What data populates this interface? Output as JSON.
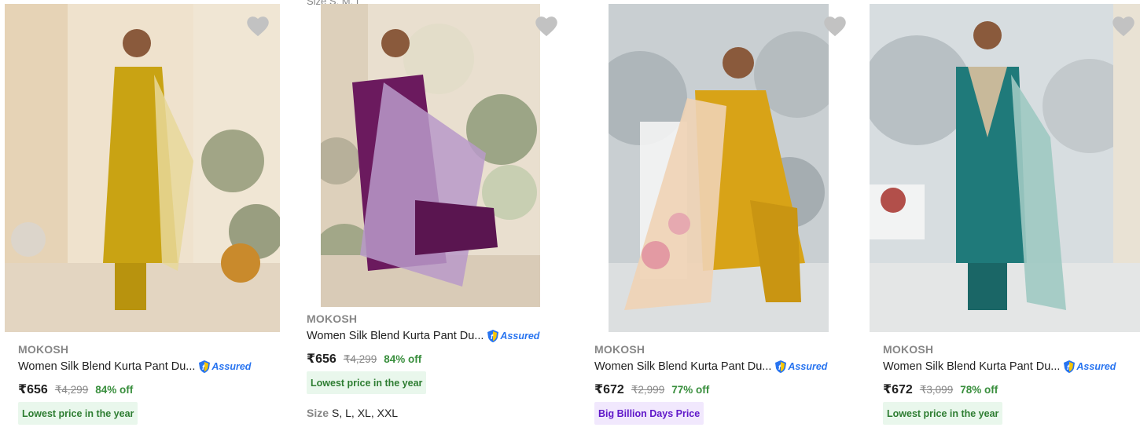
{
  "products": [
    {
      "brand": "MOKOSH",
      "title": "Women Silk Blend Kurta Pant Du...",
      "assured": "Assured",
      "price": "₹656",
      "mrp": "₹4,299",
      "discount": "84% off",
      "badge": "Lowest price in the year",
      "badge_style": "green",
      "image_alt": "Model in mustard yellow silk kurta with printed dupatta",
      "kurta_color": "#c9a313"
    },
    {
      "brand": "MOKOSH",
      "title": "Women Silk Blend Kurta Pant Du...",
      "assured": "Assured",
      "price": "₹656",
      "mrp": "₹4,299",
      "discount": "84% off",
      "badge": "Lowest price in the year",
      "badge_style": "green",
      "size_label": "Size",
      "sizes": "S, L, XL, XXL",
      "cut_text": "Size S, M, L",
      "image_alt": "Model in purple silk kurta with lavender floral dupatta",
      "kurta_color": "#6b1a5e"
    },
    {
      "brand": "MOKOSH",
      "title": "Women Silk Blend Kurta Pant Du...",
      "assured": "Assured",
      "price": "₹672",
      "mrp": "₹2,999",
      "discount": "77% off",
      "badge": "Big Billion Days Price",
      "badge_style": "purple",
      "image_alt": "Model seated in yellow kurta with floral organza dupatta",
      "kurta_color": "#d8a317"
    },
    {
      "brand": "MOKOSH",
      "title": "Women Silk Blend Kurta Pant Du...",
      "assured": "Assured",
      "price": "₹672",
      "mrp": "₹3,099",
      "discount": "78% off",
      "badge": "Lowest price in the year",
      "badge_style": "green",
      "image_alt": "Model in teal silk kurta with embroidered yoke and printed dupatta",
      "kurta_color": "#1f7a7a"
    }
  ],
  "colors": {
    "discount_green": "#388e3c",
    "badge_green_bg": "#e9f7ec",
    "badge_purple_bg": "#f1e8fd",
    "assured_blue": "#2874f0",
    "heart_grey": "#c2c2c2"
  },
  "icons": {
    "wishlist": "heart-icon",
    "assured": "flipkart-assured-icon"
  }
}
